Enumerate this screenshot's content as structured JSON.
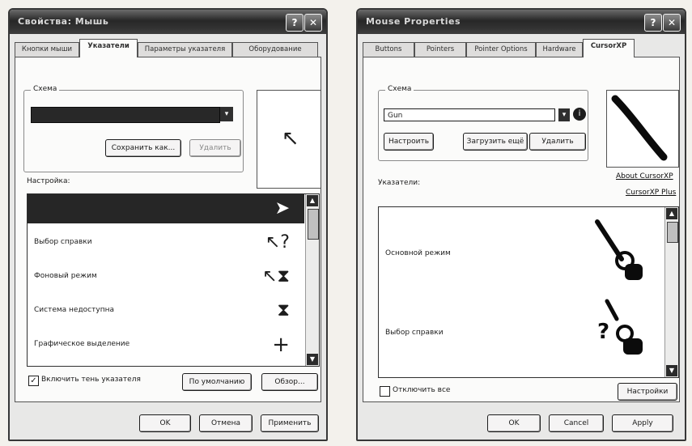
{
  "left_window": {
    "title": "Свойства: Мышь",
    "tabs": [
      {
        "label": "Кнопки мыши"
      },
      {
        "label": "Указатели"
      },
      {
        "label": "Параметры указателя"
      },
      {
        "label": "Оборудование"
      }
    ],
    "scheme_label": "Схема",
    "save_as_label": "Сохранить как...",
    "delete_label": "Удалить",
    "customize_label": "Настройка:",
    "rows": [
      {
        "label": "",
        "icon": "arrow-cursor-icon",
        "glyph": "➤"
      },
      {
        "label": "Выбор справки",
        "icon": "help-cursor-icon",
        "glyph": "↖?"
      },
      {
        "label": "Фоновый режим",
        "icon": "busy-arrow-cursor-icon",
        "glyph": "↖⧗"
      },
      {
        "label": "Система недоступна",
        "icon": "hourglass-icon",
        "glyph": "⧗"
      },
      {
        "label": "Графическое выделение",
        "icon": "crosshair-icon",
        "glyph": "+"
      }
    ],
    "shadow_label": "Включить тень указателя",
    "default_label": "По умолчанию",
    "browse_label": "Обзор...",
    "ok_label": "OK",
    "cancel_label": "Отмена",
    "apply_label": "Применить"
  },
  "right_window": {
    "title": "Mouse Properties",
    "tabs": [
      {
        "label": "Buttons"
      },
      {
        "label": "Pointers"
      },
      {
        "label": "Pointer Options"
      },
      {
        "label": "Hardware"
      },
      {
        "label": "CursorXP"
      }
    ],
    "scheme_label": "Схема",
    "scheme_value": "Gun",
    "customize_label": "Настроить",
    "download_label": "Загрузить ещё",
    "delete_label": "Удалить",
    "pointers_label": "Указатели:",
    "about_link": "About CursorXP",
    "plus_link": "CursorXP Plus",
    "rows": [
      {
        "label": "Основной режим",
        "icon": "gun-cursor-icon"
      },
      {
        "label": "Выбор справки",
        "icon": "gun-help-cursor-icon"
      }
    ],
    "disable_all_label": "Отключить все",
    "settings_label": "Настройки",
    "ok_label": "OK",
    "cancel_label": "Cancel",
    "apply_label": "Apply"
  }
}
